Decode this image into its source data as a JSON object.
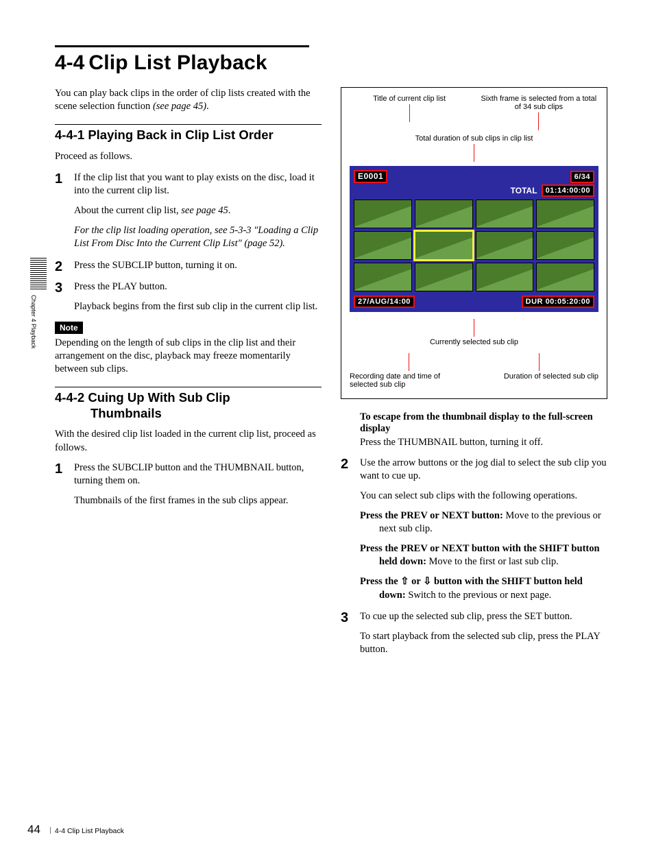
{
  "tab": {
    "label": "Chapter 4  Playback"
  },
  "header": {
    "number": "4-4",
    "title": "Clip List Playback"
  },
  "intro": {
    "line1": "You can play back clips in the order of clip lists created with the scene selection function ",
    "ref": "(see page 45)",
    "dot": "."
  },
  "s441": {
    "title": "4-4-1 Playing Back in Clip List Order",
    "lead": "Proceed as follows.",
    "step1a": "If the clip list that you want to play exists on the disc, load it into the current clip list.",
    "step1b_1": "About the current clip list, ",
    "step1b_ref": "see page 45",
    "step1b_2": ".",
    "step1c": "For the clip list loading operation, see 5-3-3 \"Loading a Clip List From Disc Into the Current Clip List\" (page 52).",
    "step2": "Press the SUBCLIP button, turning it on.",
    "step3a": "Press the PLAY button.",
    "step3b": "Playback begins from the first sub clip in the current clip list.",
    "note_tag": "Note",
    "note_body": "Depending on the length of sub clips in the clip list and their arrangement on the disc, playback may freeze momentarily between sub clips."
  },
  "s442": {
    "title_l1": "4-4-2 Cuing Up With Sub Clip",
    "title_l2": "Thumbnails",
    "lead": "With the desired clip list loaded in the current clip list, proceed as follows.",
    "step1a": "Press the SUBCLIP button and the THUMBNAIL button, turning them on.",
    "step1b": "Thumbnails of the first frames in the sub clips appear."
  },
  "figure": {
    "lbl_title": "Title of current clip list",
    "lbl_count": "Sixth frame is selected from a total of 34 sub clips",
    "lbl_total": "Total duration of sub clips in clip list",
    "lbl_sel": "Currently selected sub clip",
    "lbl_recdt": "Recording date and time of selected sub clip",
    "lbl_dur": "Duration of selected sub clip",
    "screen": {
      "title": "E0001",
      "count": "6/34",
      "total_label": "TOTAL",
      "total_value": "01:14:00:00",
      "rec_dt": "27/AUG/14:00",
      "dur_label": "DUR",
      "dur_value": "00:05:20:00"
    }
  },
  "right": {
    "escape_h1": "To escape from the thumbnail display to the full-screen display",
    "escape_body": "Press the THUMBNAIL button, turning it off.",
    "step2a": "Use the arrow buttons or the jog dial to select the sub clip you want to cue up.",
    "step2b": "You can select sub clips with the following operations.",
    "op1_b": "Press the PREV or NEXT button: ",
    "op1_t": "Move to the previous or next sub clip.",
    "op2_b": "Press the PREV or NEXT button with the SHIFT button held down: ",
    "op2_t": "Move to the first or last sub clip.",
    "op3_b1": "Press the ",
    "op3_up": "⇧",
    "op3_or": " or ",
    "op3_dn": "⇩",
    "op3_b2": " button with the SHIFT button held down: ",
    "op3_t": "Switch to the previous or next page.",
    "step3a": "To cue up the selected sub clip, press the SET button.",
    "step3b": "To start playback from the selected sub clip, press the PLAY button."
  },
  "footer": {
    "page": "44",
    "title": "4-4  Clip List Playback"
  }
}
